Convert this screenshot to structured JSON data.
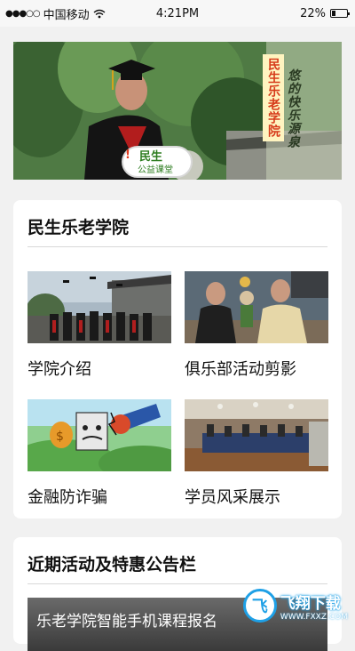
{
  "status_bar": {
    "signal": "●●●○○",
    "carrier": "中国移动",
    "time": "4:21PM",
    "battery_percent": "22%",
    "battery_level": 0.22
  },
  "hero": {
    "vertical_title": "民生乐老学院",
    "vertical_slogan": "悠的快乐源泉",
    "board_mark": "!",
    "board_line1": "民生",
    "board_line2": "公益课堂"
  },
  "college_section": {
    "title": "民生乐老学院",
    "tiles": [
      {
        "label": "学院介绍"
      },
      {
        "label": "俱乐部活动剪影"
      },
      {
        "label": "金融防诈骗"
      },
      {
        "label": "学员风采展示"
      }
    ]
  },
  "notice_section": {
    "title": "近期活动及特惠公告栏",
    "item_text": "乐老学院智能手机课程报名"
  },
  "watermark": {
    "logo": "飞",
    "name": "飞翔下载",
    "url": "WWW.FXXZ.COM"
  }
}
